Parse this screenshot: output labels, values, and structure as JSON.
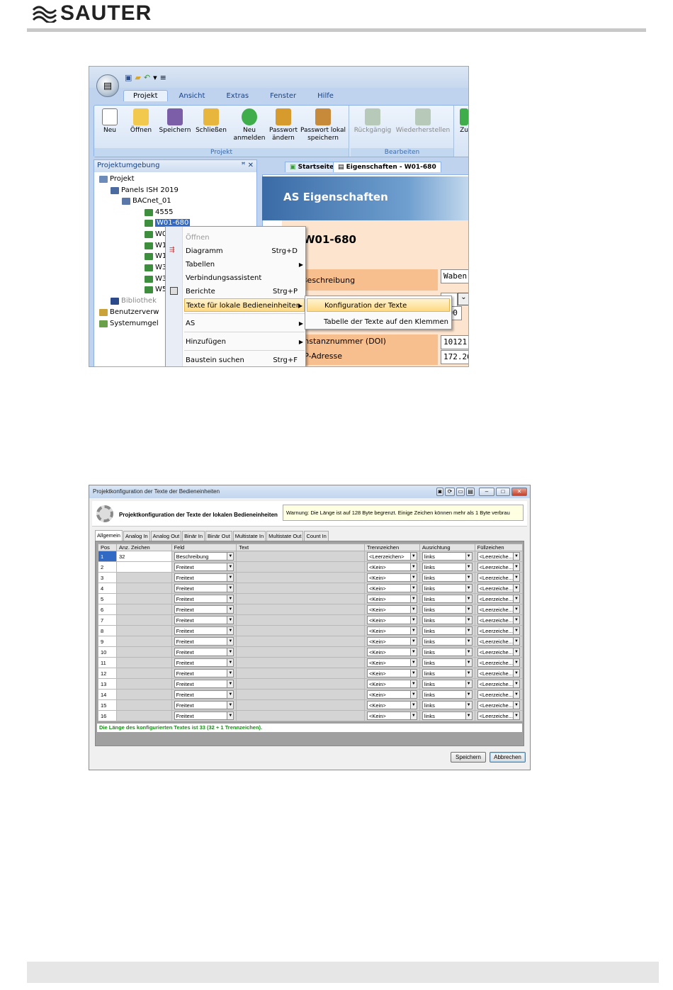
{
  "brand": {
    "name": "SAUTER"
  },
  "shot1": {
    "ribbon_tabs": [
      "Projekt",
      "Ansicht",
      "Extras",
      "Fenster",
      "Hilfe"
    ],
    "buttons": {
      "new": "Neu",
      "open": "Öffnen",
      "save": "Speichern",
      "close": "Schließen",
      "relogin_1": "Neu",
      "relogin_2": "anmelden",
      "pw_change_1": "Passwort",
      "pw_change_2": "ändern",
      "pw_local_1": "Passwort lokal",
      "pw_local_2": "speichern",
      "undo": "Rückgängig",
      "redo": "Wiederherstellen",
      "back": "Zu"
    },
    "groups": {
      "project": "Projekt",
      "edit": "Bearbeiten"
    },
    "pane_title": "Projektumgebung",
    "pane_controls": " ✕",
    "tree": {
      "root": "Projekt",
      "panels": "Panels ISH 2019",
      "bacnet": "BACnet_01",
      "dev1": "4555",
      "dev2": "W01-680",
      "dev_w0": "W0",
      "dev_w1": "W1",
      "dev_w1b": "W1",
      "dev_w3": "W3",
      "dev_w3b": "W3",
      "dev_w5": "W5",
      "library": "Bibliothek",
      "users": "Benutzerverw",
      "system": "Systemumgel"
    },
    "doc_tabs": {
      "start": "Startseite",
      "props": "Eigenschaften - W01-680"
    },
    "as_title": "AS Eigenschaften",
    "as_id": "W01-680",
    "as_labels": {
      "desc": "Beschreibung",
      "doi": "Instanznummer (DOI)",
      "ip": "IP-Adresse"
    },
    "as_values": {
      "desc": "Waben",
      "v2": "8",
      "v3": "000",
      "doi": "10121",
      "ip": "172.26"
    },
    "context_menu": {
      "open": "Öffnen",
      "diagram": "Diagramm",
      "diagram_sc": "Strg+D",
      "tables": "Tabellen",
      "wizard": "Verbindungsassistent",
      "reports": "Berichte",
      "reports_sc": "Strg+P",
      "texts": "Texte für lokale Bedieneinheiten",
      "as": "AS",
      "add": "Hinzufügen",
      "search": "Baustein suchen",
      "search_sc": "Strg+F"
    },
    "submenu": {
      "config": "Konfiguration der Texte",
      "table": "Tabelle der Texte auf den Klemmen"
    }
  },
  "shot2": {
    "window_title": "Projektkonfiguration der Texte der Bedieneinheiten",
    "header_title": "Projektkonfiguration der Texte der lokalen Bedieneinheiten",
    "warning": "Warnung: Die Länge ist auf 128 Byte begrenzt. Einige Zeichen können mehr als 1 Byte verbrau",
    "tabs": [
      "Allgemein",
      "Analog In",
      "Analog Out",
      "Binär In",
      "Binär Out",
      "Multistate In",
      "Multistate Out",
      "Count In"
    ],
    "columns": [
      "Pos",
      "Anz. Zeichen",
      "Feld",
      "Text",
      "Trennzeichen",
      "Ausrichtung",
      "Füllzeichen"
    ],
    "rows": [
      {
        "pos": "1",
        "count": "32",
        "field": "Beschreibung",
        "sep": "<Leerzeichen>",
        "align": "links",
        "fill": "<Leerzeiche..."
      },
      {
        "pos": "2",
        "count": "",
        "field": "Freitext",
        "sep": "<Kein>",
        "align": "links",
        "fill": "<Leerzeiche..."
      },
      {
        "pos": "3",
        "count": "",
        "field": "Freitext",
        "sep": "<Kein>",
        "align": "links",
        "fill": "<Leerzeiche..."
      },
      {
        "pos": "4",
        "count": "",
        "field": "Freitext",
        "sep": "<Kein>",
        "align": "links",
        "fill": "<Leerzeiche..."
      },
      {
        "pos": "5",
        "count": "",
        "field": "Freitext",
        "sep": "<Kein>",
        "align": "links",
        "fill": "<Leerzeiche..."
      },
      {
        "pos": "6",
        "count": "",
        "field": "Freitext",
        "sep": "<Kein>",
        "align": "links",
        "fill": "<Leerzeiche..."
      },
      {
        "pos": "7",
        "count": "",
        "field": "Freitext",
        "sep": "<Kein>",
        "align": "links",
        "fill": "<Leerzeiche..."
      },
      {
        "pos": "8",
        "count": "",
        "field": "Freitext",
        "sep": "<Kein>",
        "align": "links",
        "fill": "<Leerzeiche..."
      },
      {
        "pos": "9",
        "count": "",
        "field": "Freitext",
        "sep": "<Kein>",
        "align": "links",
        "fill": "<Leerzeiche..."
      },
      {
        "pos": "10",
        "count": "",
        "field": "Freitext",
        "sep": "<Kein>",
        "align": "links",
        "fill": "<Leerzeiche..."
      },
      {
        "pos": "11",
        "count": "",
        "field": "Freitext",
        "sep": "<Kein>",
        "align": "links",
        "fill": "<Leerzeiche..."
      },
      {
        "pos": "12",
        "count": "",
        "field": "Freitext",
        "sep": "<Kein>",
        "align": "links",
        "fill": "<Leerzeiche..."
      },
      {
        "pos": "13",
        "count": "",
        "field": "Freitext",
        "sep": "<Kein>",
        "align": "links",
        "fill": "<Leerzeiche..."
      },
      {
        "pos": "14",
        "count": "",
        "field": "Freitext",
        "sep": "<Kein>",
        "align": "links",
        "fill": "<Leerzeiche..."
      },
      {
        "pos": "15",
        "count": "",
        "field": "Freitext",
        "sep": "<Kein>",
        "align": "links",
        "fill": "<Leerzeiche..."
      },
      {
        "pos": "16",
        "count": "",
        "field": "Freitext",
        "sep": "<Kein>",
        "align": "links",
        "fill": "<Leerzeiche..."
      }
    ],
    "status": "Die Länge des konfigurierten Textes ist 33 (32 + 1 Trennzeichen).",
    "save": "Speichern",
    "cancel": "Abbrechen"
  }
}
